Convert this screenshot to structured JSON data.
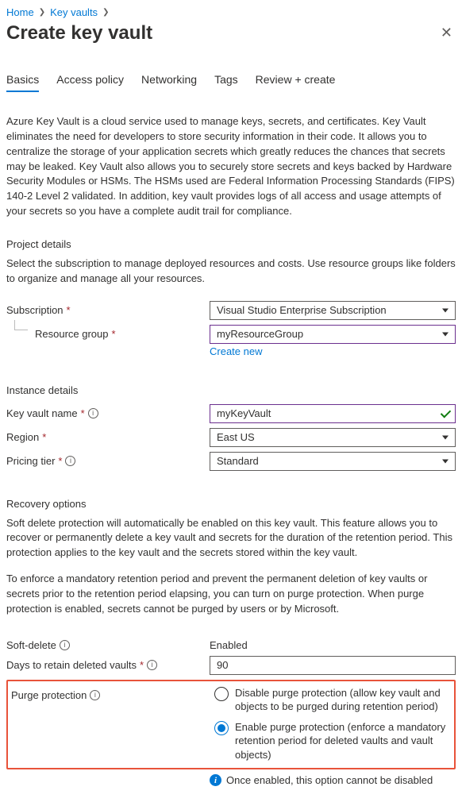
{
  "breadcrumb": {
    "home": "Home",
    "kv": "Key vaults"
  },
  "title": "Create key vault",
  "tabs": [
    "Basics",
    "Access policy",
    "Networking",
    "Tags",
    "Review + create"
  ],
  "intro": "Azure Key Vault is a cloud service used to manage keys, secrets, and certificates. Key Vault eliminates the need for developers to store security information in their code. It allows you to centralize the storage of your application secrets which greatly reduces the chances that secrets may be leaked. Key Vault also allows you to securely store secrets and keys backed by Hardware Security Modules or HSMs. The HSMs used are Federal Information Processing Standards (FIPS) 140-2 Level 2 validated. In addition, key vault provides logs of all access and usage attempts of your secrets so you have a complete audit trail for compliance.",
  "projectDetails": {
    "heading": "Project details",
    "desc": "Select the subscription to manage deployed resources and costs. Use resource groups like folders to organize and manage all your resources.",
    "subscriptionLabel": "Subscription",
    "subscriptionValue": "Visual Studio Enterprise Subscription",
    "resourceGroupLabel": "Resource group",
    "resourceGroupValue": "myResourceGroup",
    "createNew": "Create new"
  },
  "instanceDetails": {
    "heading": "Instance details",
    "kvNameLabel": "Key vault name",
    "kvNameValue": "myKeyVault",
    "regionLabel": "Region",
    "regionValue": "East US",
    "tierLabel": "Pricing tier",
    "tierValue": "Standard"
  },
  "recovery": {
    "heading": "Recovery options",
    "p1": "Soft delete protection will automatically be enabled on this key vault. This feature allows you to recover or permanently delete a key vault and secrets for the duration of the retention period. This protection applies to the key vault and the secrets stored within the key vault.",
    "p2": "To enforce a mandatory retention period and prevent the permanent deletion of key vaults or secrets prior to the retention period elapsing, you can turn on purge protection. When purge protection is enabled, secrets cannot be purged by users or by Microsoft.",
    "softDeleteLabel": "Soft-delete",
    "softDeleteValue": "Enabled",
    "daysLabel": "Days to retain deleted vaults",
    "daysValue": "90",
    "purgeLabel": "Purge protection",
    "purgeOpt1": "Disable purge protection (allow key vault and objects to be purged during retention period)",
    "purgeOpt2": "Enable purge protection (enforce a mandatory retention period for deleted vaults and vault objects)",
    "note": "Once enabled, this option cannot be disabled"
  }
}
